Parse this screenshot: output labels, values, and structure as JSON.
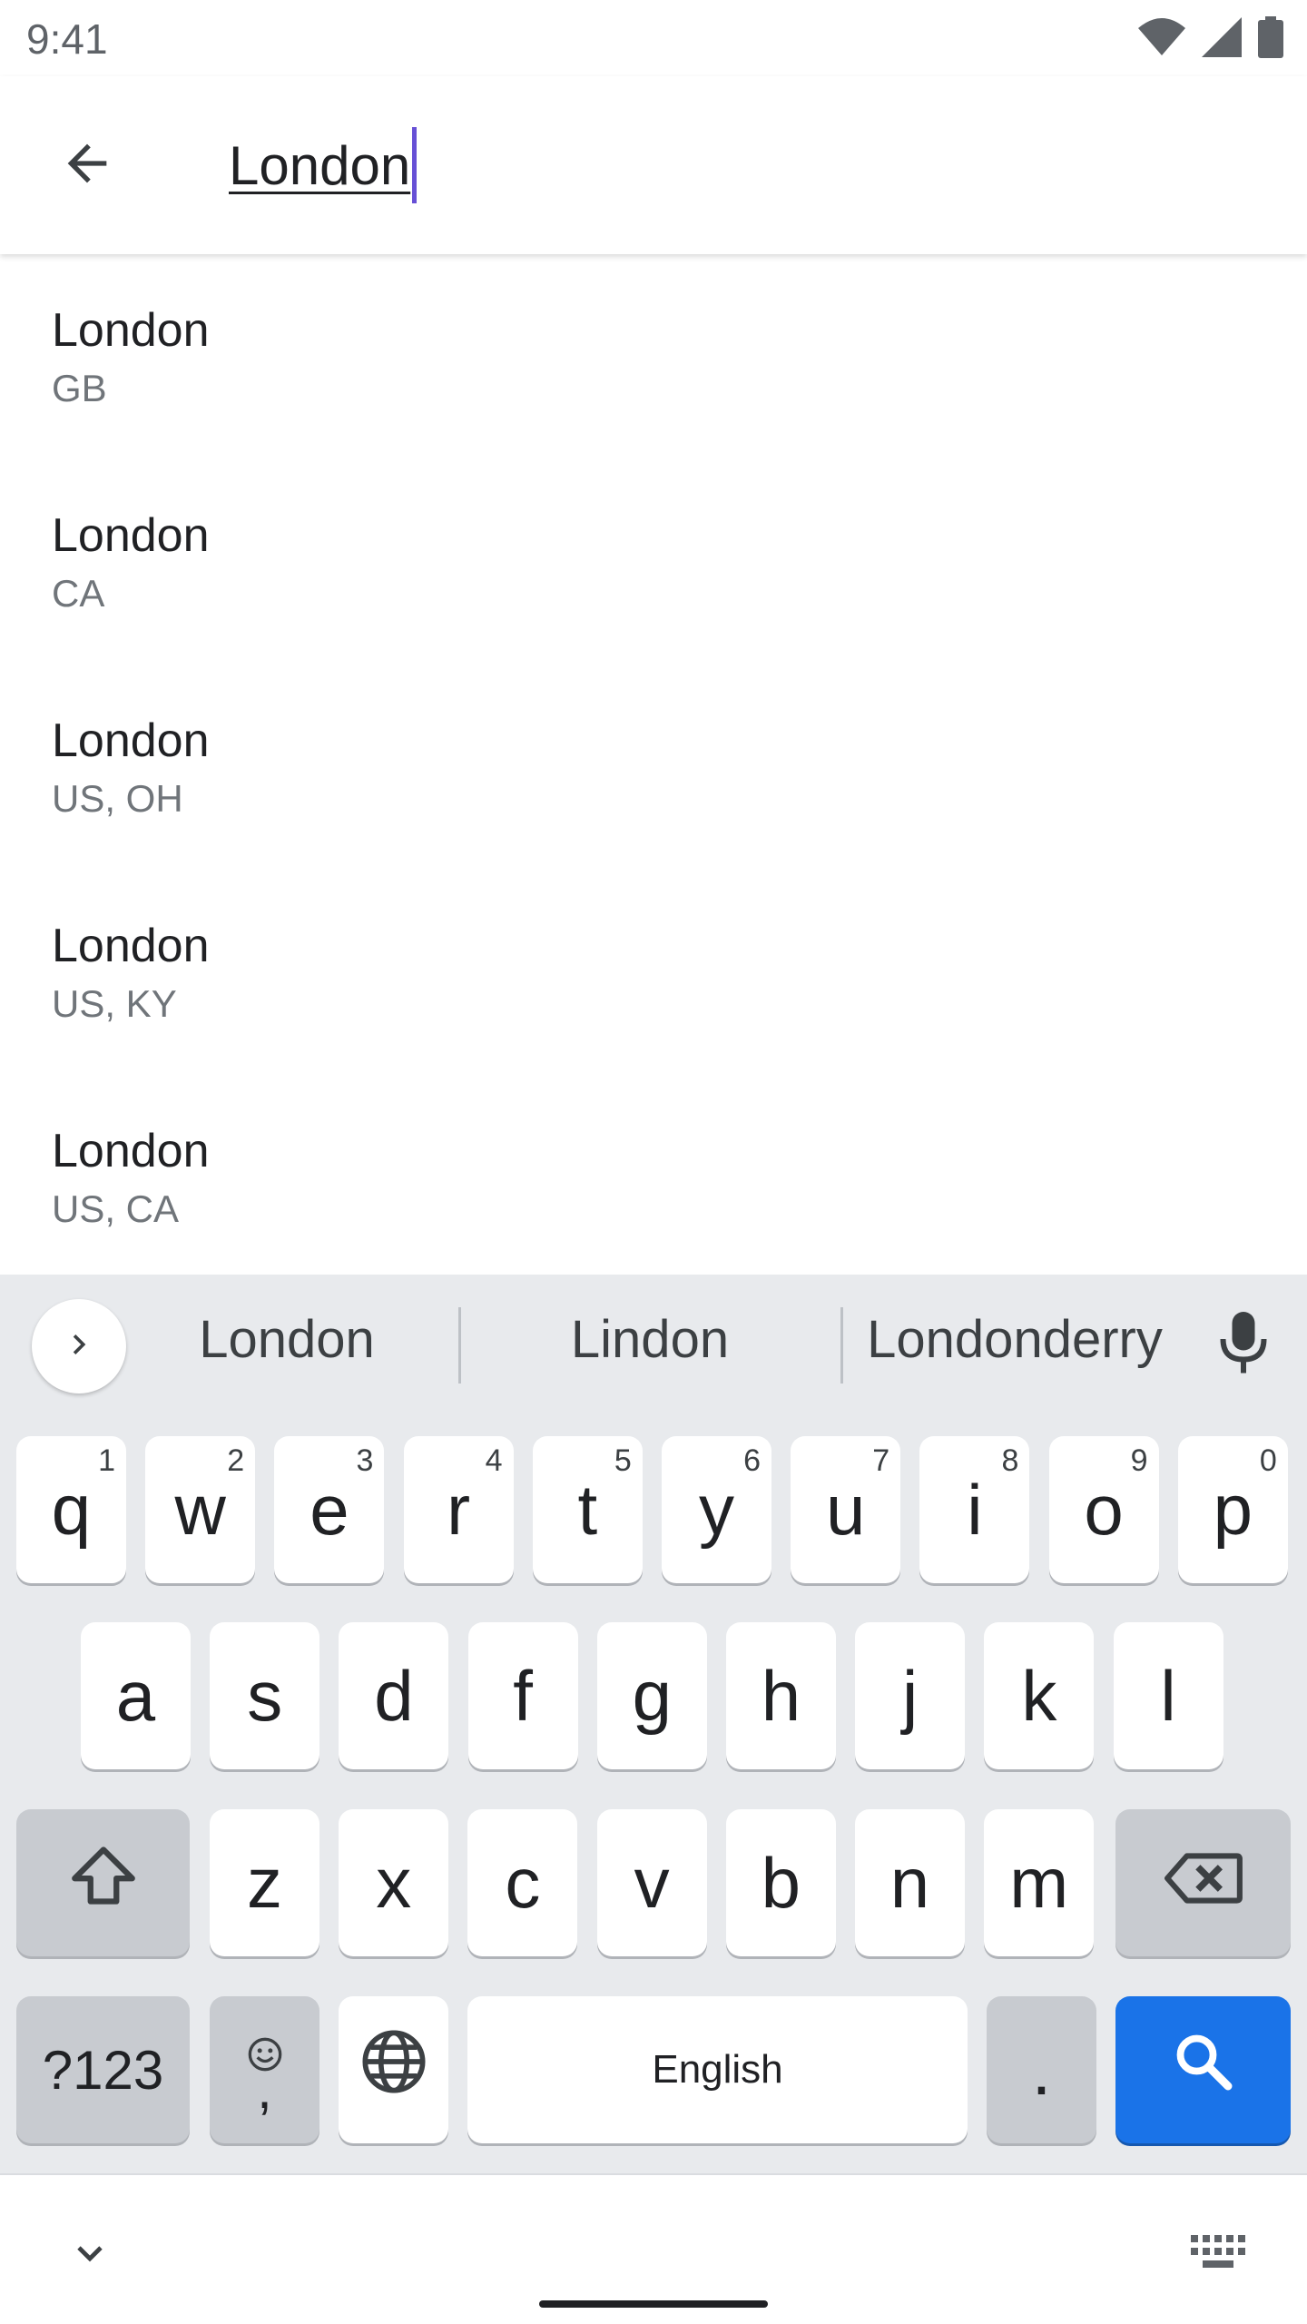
{
  "status_bar": {
    "time": "9:41",
    "icons": [
      "wifi-icon",
      "cellular-signal-icon",
      "battery-icon"
    ]
  },
  "search": {
    "value": "London",
    "back_icon": "arrow-back-icon",
    "caret_color": "#6750d6"
  },
  "results": [
    {
      "city": "London",
      "region": "GB"
    },
    {
      "city": "London",
      "region": "CA"
    },
    {
      "city": "London",
      "region": "US, OH"
    },
    {
      "city": "London",
      "region": "US, KY"
    },
    {
      "city": "London",
      "region": "US, CA"
    }
  ],
  "keyboard": {
    "suggestions": [
      "London",
      "Lindon",
      "Londonderry"
    ],
    "row1": [
      {
        "key": "q",
        "hint": "1"
      },
      {
        "key": "w",
        "hint": "2"
      },
      {
        "key": "e",
        "hint": "3"
      },
      {
        "key": "r",
        "hint": "4"
      },
      {
        "key": "t",
        "hint": "5"
      },
      {
        "key": "y",
        "hint": "6"
      },
      {
        "key": "u",
        "hint": "7"
      },
      {
        "key": "i",
        "hint": "8"
      },
      {
        "key": "o",
        "hint": "9"
      },
      {
        "key": "p",
        "hint": "0"
      }
    ],
    "row2": [
      "a",
      "s",
      "d",
      "f",
      "g",
      "h",
      "j",
      "k",
      "l"
    ],
    "row3": [
      "z",
      "x",
      "c",
      "v",
      "b",
      "n",
      "m"
    ],
    "symbols_label": "?123",
    "comma_label": ",",
    "space_label": "English",
    "period_label": ".",
    "accent_color": "#1a73e8"
  }
}
